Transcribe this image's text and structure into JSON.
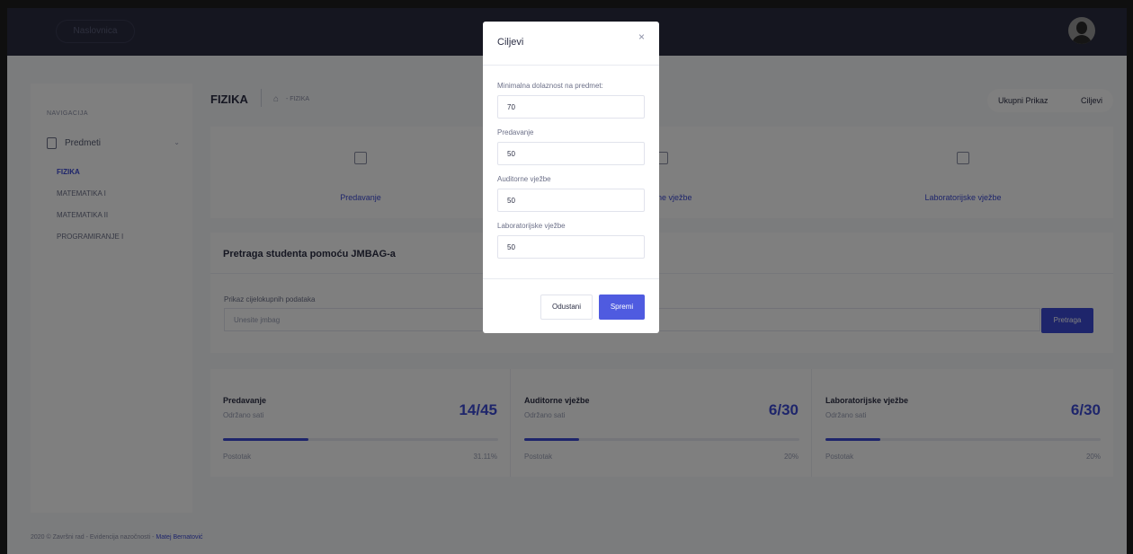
{
  "topbar": {
    "home_label": "Naslovnica",
    "avatar_icon": "user-avatar-icon"
  },
  "sidebar": {
    "title": "NAVIGACIJA",
    "group_label": "Predmeti",
    "items": [
      {
        "label": "FIZIKA",
        "active": true
      },
      {
        "label": "MATEMATIKA I",
        "active": false
      },
      {
        "label": "MATEMATIKA II",
        "active": false
      },
      {
        "label": "PROGRAMIRANJE I",
        "active": false
      }
    ]
  },
  "header": {
    "title": "FIZIKA",
    "breadcrumb": "- FIZIKA",
    "action_overview": "Ukupni Prikaz",
    "action_goals": "Ciljevi"
  },
  "types": [
    {
      "label": "Predavanje",
      "icon": "lecture-icon"
    },
    {
      "label": "Auditorne vježbe",
      "icon": "pencil-icon"
    },
    {
      "label": "Laboratorijske vježbe",
      "icon": "lab-icon"
    }
  ],
  "search": {
    "title": "Pretraga studenta pomoću JMBAG-a",
    "label": "Prikaz cijelokupnih podataka",
    "placeholder": "Unesite jmbag",
    "button": "Pretraga"
  },
  "stats": [
    {
      "name": "Predavanje",
      "sub": "Održano sati",
      "value": "14/45",
      "percent_label": "Postotak",
      "percent": "31.11%",
      "progress": 0.311
    },
    {
      "name": "Auditorne vježbe",
      "sub": "Održano sati",
      "value": "6/30",
      "percent_label": "Postotak",
      "percent": "20%",
      "progress": 0.2
    },
    {
      "name": "Laboratorijske vježbe",
      "sub": "Održano sati",
      "value": "6/30",
      "percent_label": "Postotak",
      "percent": "20%",
      "progress": 0.2
    }
  ],
  "footer": {
    "text": "2020 © Završni rad - Evidencija nazočnosti - ",
    "author": "Matej Bernatović"
  },
  "modal": {
    "title": "Ciljevi",
    "fields": [
      {
        "label": "Minimalna dolaznost na predmet:",
        "value": "70"
      },
      {
        "label": "Predavanje",
        "value": "50"
      },
      {
        "label": "Auditorne vježbe",
        "value": "50"
      },
      {
        "label": "Laboratorijske vježbe",
        "value": "50"
      }
    ],
    "cancel": "Odustani",
    "save": "Spremi"
  },
  "colors": {
    "primary": "#3d4bd6",
    "topbar": "#2a2c40",
    "overlay": "rgba(0,0,0,0.5)"
  }
}
